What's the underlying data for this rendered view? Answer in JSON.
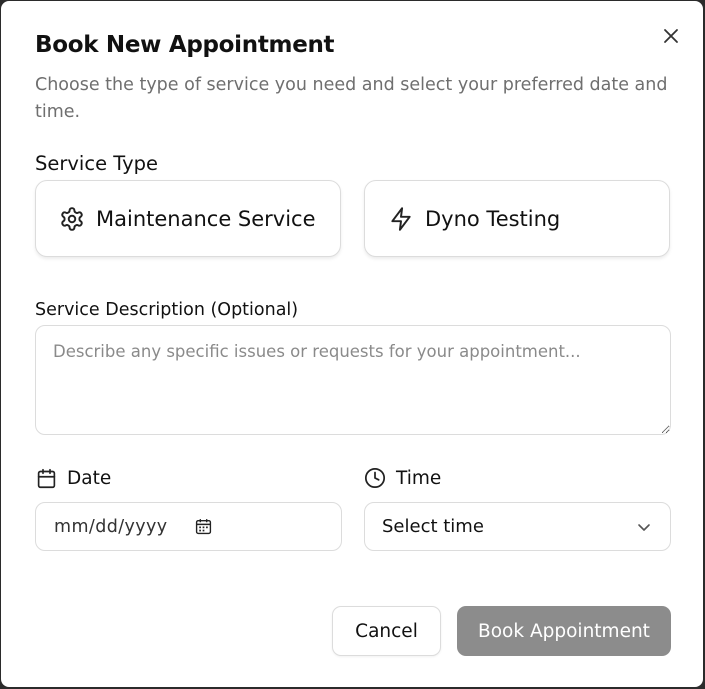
{
  "dialog": {
    "title": "Book New Appointment",
    "subtitle": "Choose the type of service you need and select your preferred date and time."
  },
  "service_type": {
    "label": "Service Type",
    "options": [
      {
        "label": "Maintenance Service",
        "icon": "gear-icon"
      },
      {
        "label": "Dyno Testing",
        "icon": "lightning-icon"
      }
    ]
  },
  "description": {
    "label": "Service Description (Optional)",
    "placeholder": "Describe any specific issues or requests for your appointment...",
    "value": ""
  },
  "date": {
    "label": "Date",
    "icon": "calendar-icon",
    "value": "mm/dd/yyyy"
  },
  "time": {
    "label": "Time",
    "icon": "clock-icon",
    "selected": "Select time"
  },
  "actions": {
    "cancel_label": "Cancel",
    "book_label": "Book Appointment"
  },
  "colors": {
    "primary_disabled": "#8c8c8c",
    "muted_text": "#6f6f6f",
    "border": "#dcdcdc"
  }
}
